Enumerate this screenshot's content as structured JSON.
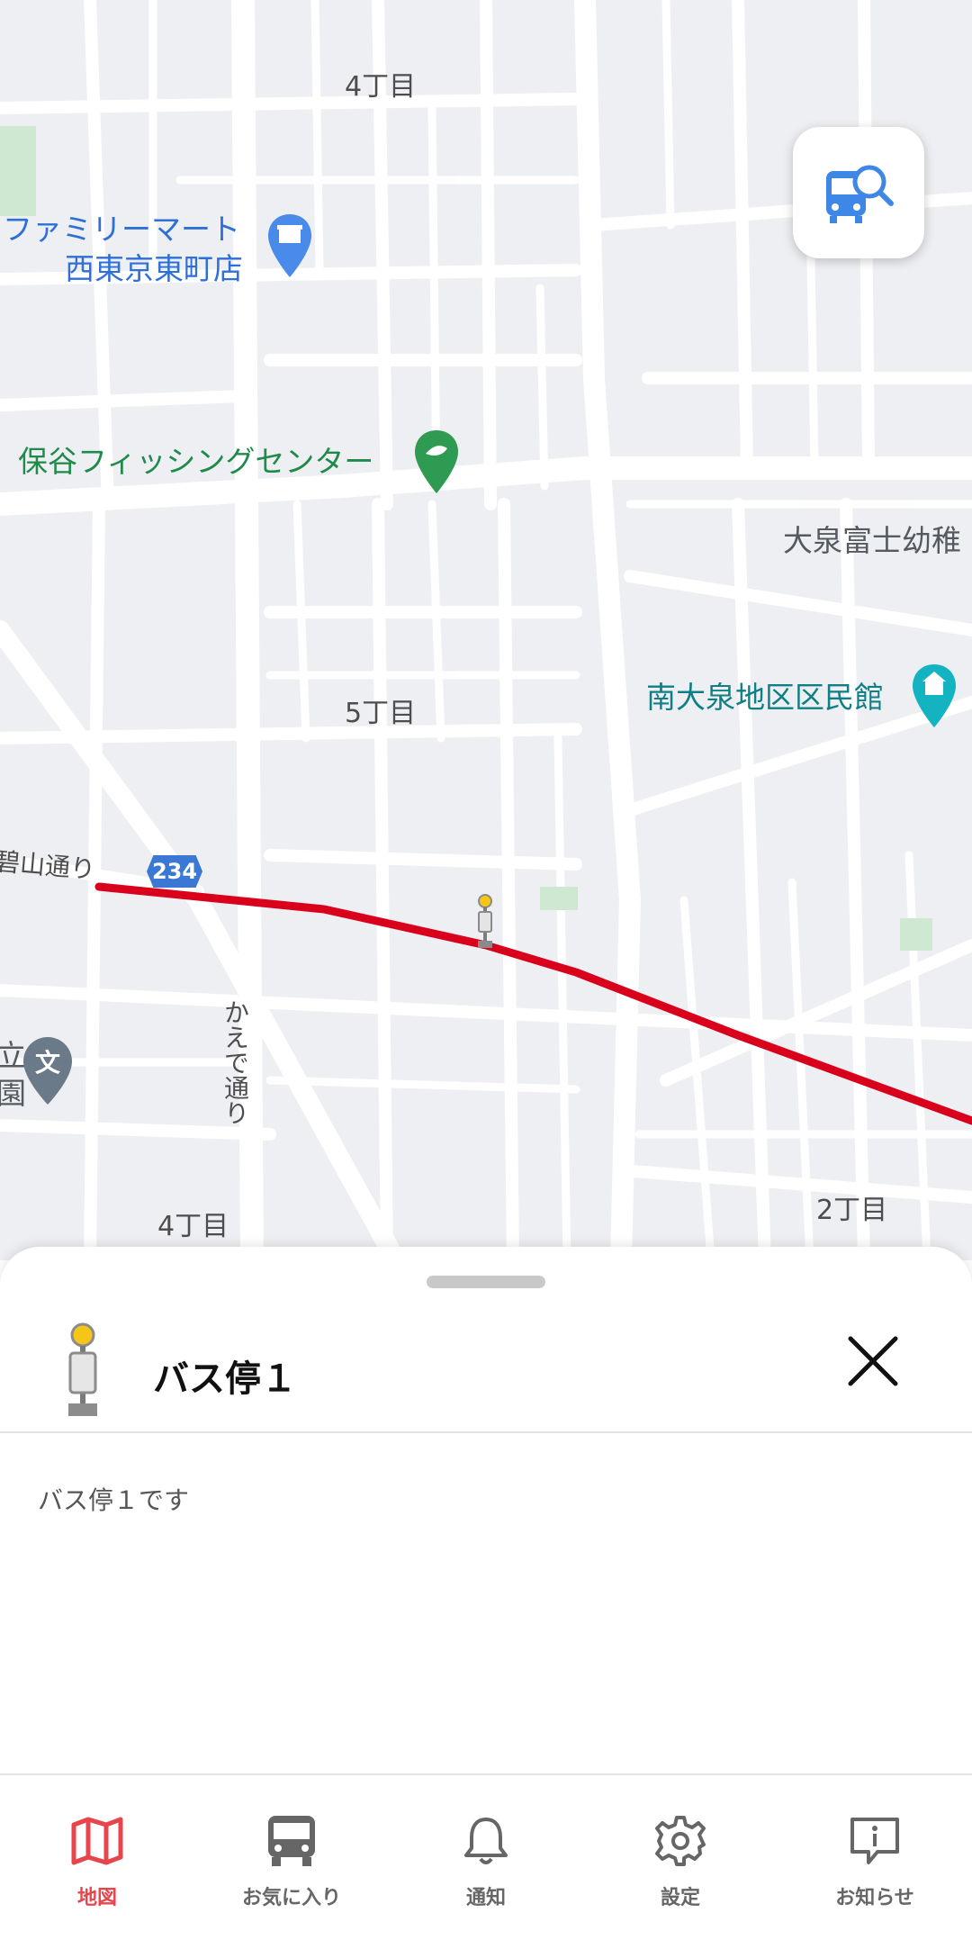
{
  "map": {
    "labels": {
      "chome4_top": "4丁目",
      "familymart_1": "ファミリーマート",
      "familymart_2": "西東京東町店",
      "hoya_fishing": "保谷フィッシングセンター",
      "oizumi_fuji": "大泉富士幼稚",
      "minami_oizumi": "南大泉地区区民館",
      "chome5": "5丁目",
      "hekizan_road": "碧山通り",
      "route_number": "234",
      "kaede_road": "かえで通り",
      "ritsu_1": "立",
      "ritsu_2": "園",
      "school_mark": "文",
      "chome4_bottom": "4丁目",
      "chome2": "2丁目"
    },
    "icons": {
      "convenience_store": "convenience-store-pin-icon",
      "fishing": "fishing-pin-icon",
      "community_hall": "community-hall-pin-icon",
      "school": "school-pin-icon",
      "bus_stop": "bus-stop-marker-icon",
      "bus_search": "bus-search-icon"
    },
    "colors": {
      "route": "#d9001b",
      "background": "#eeeff2",
      "road": "#ffffff"
    }
  },
  "sheet": {
    "title": "バス停１",
    "description": "バス停１です",
    "close_icon": "close-icon",
    "stop_icon": "bus-stop-icon"
  },
  "nav": {
    "active_color": "#e8444b",
    "items": [
      {
        "label": "地図",
        "icon": "map-icon",
        "active": true
      },
      {
        "label": "お気に入り",
        "icon": "bus-icon",
        "active": false
      },
      {
        "label": "通知",
        "icon": "bell-icon",
        "active": false
      },
      {
        "label": "設定",
        "icon": "gear-icon",
        "active": false
      },
      {
        "label": "お知らせ",
        "icon": "info-bubble-icon",
        "active": false
      }
    ]
  }
}
